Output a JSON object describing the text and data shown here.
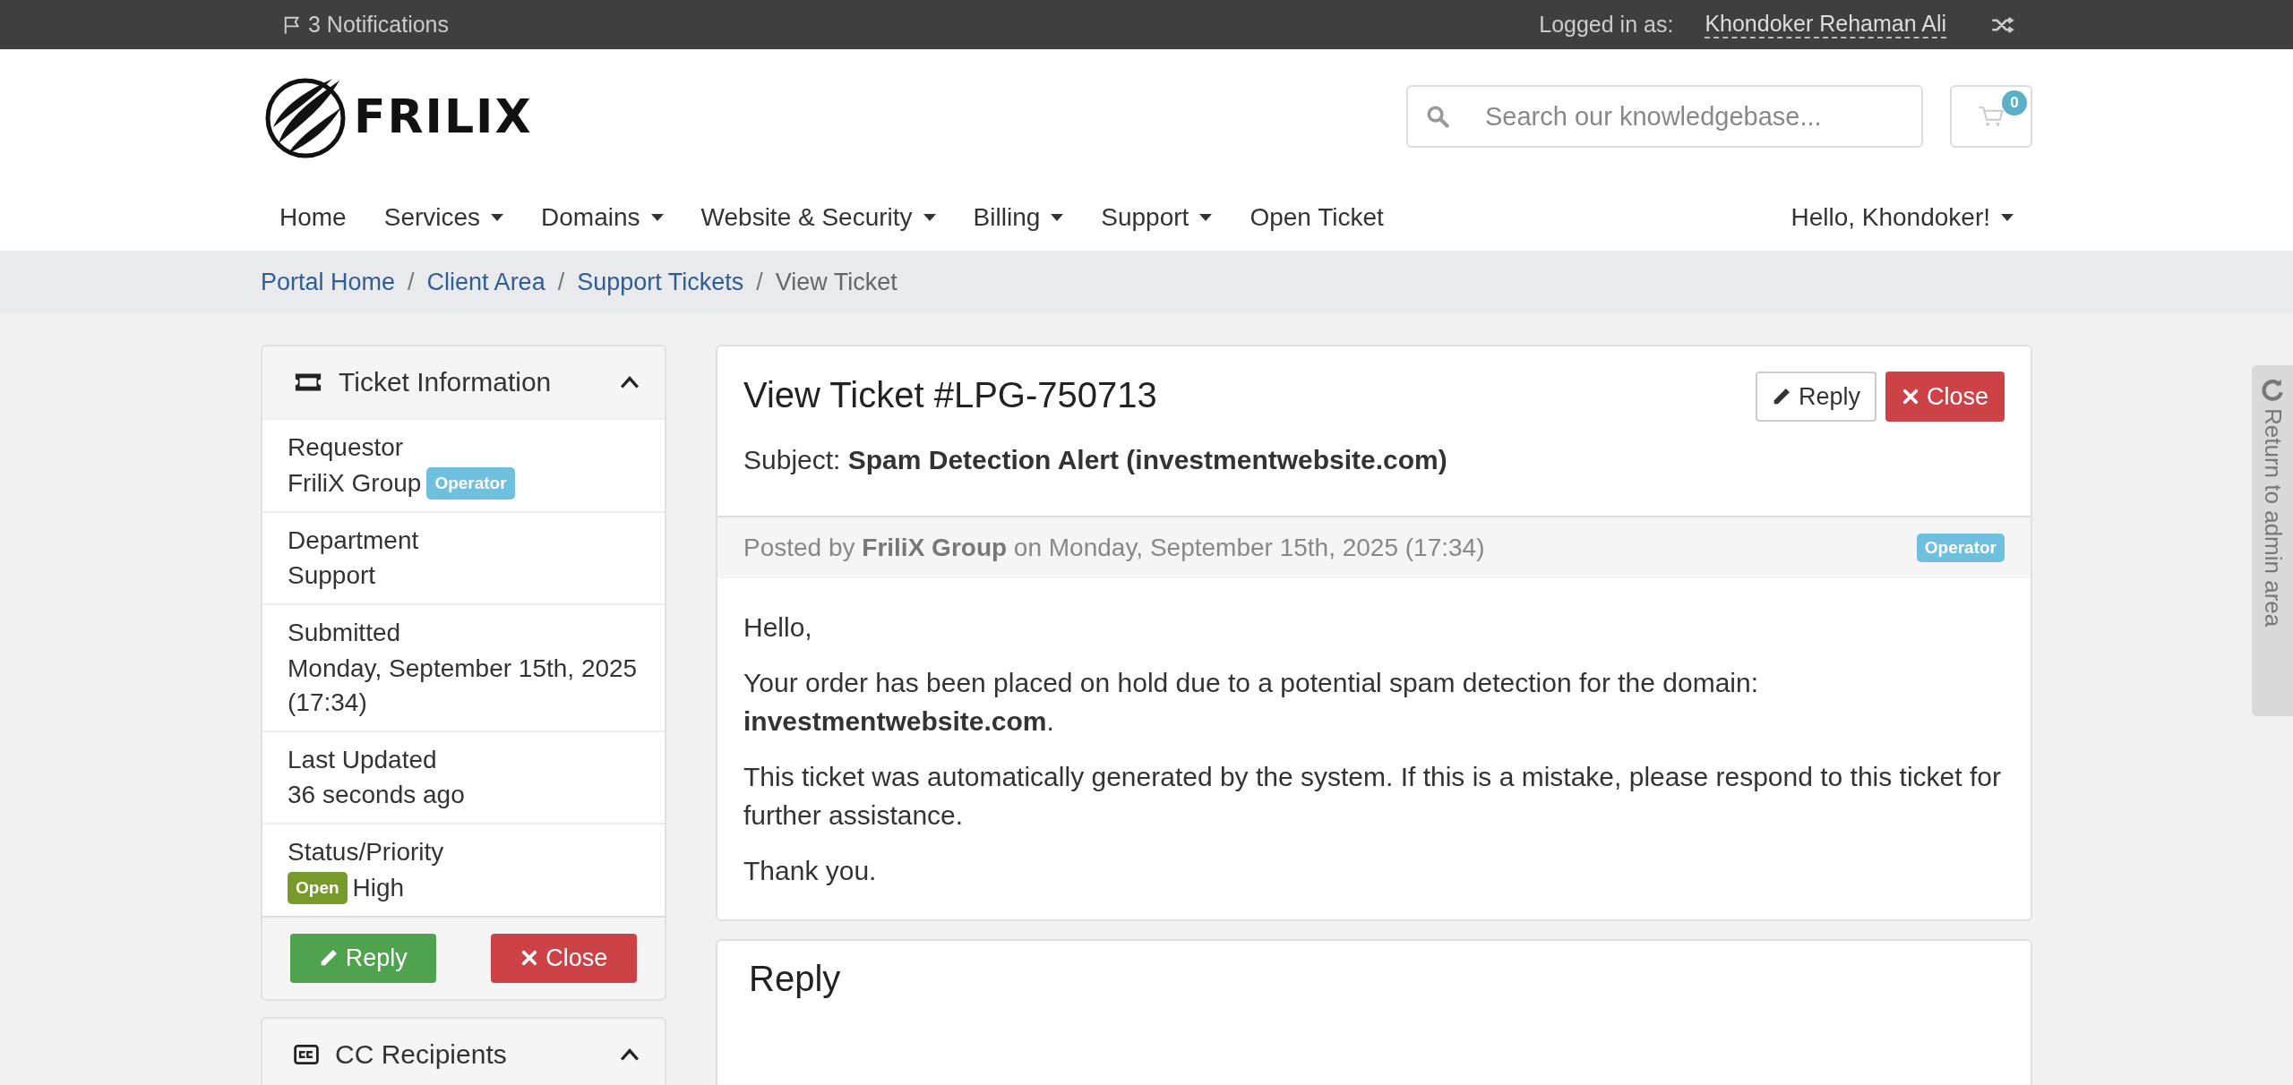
{
  "top_bar": {
    "notifications": "3 Notifications",
    "logged_in_label": "Logged in as:",
    "user_name": "Khondoker Rehaman Ali"
  },
  "header": {
    "logo_text": "FRILIX",
    "search": {
      "placeholder": "Search our knowledgebase..."
    },
    "cart_count": "0"
  },
  "nav": {
    "items": [
      {
        "label": "Home",
        "dropdown": false
      },
      {
        "label": "Services",
        "dropdown": true
      },
      {
        "label": "Domains",
        "dropdown": true
      },
      {
        "label": "Website & Security",
        "dropdown": true
      },
      {
        "label": "Billing",
        "dropdown": true
      },
      {
        "label": "Support",
        "dropdown": true
      },
      {
        "label": "Open Ticket",
        "dropdown": false
      }
    ],
    "user_menu": {
      "label": "Hello, Khondoker!",
      "dropdown": true
    }
  },
  "breadcrumb": [
    {
      "label": "Portal Home",
      "selected": false
    },
    {
      "label": "Client Area",
      "selected": false,
      "separator": "/"
    },
    {
      "label": "Support Tickets",
      "selected": false,
      "separator": "/"
    },
    {
      "label": "View Ticket",
      "selected": true,
      "separator": "/"
    }
  ],
  "sidebar": {
    "ticket_information": {
      "title": "Ticket Information",
      "expanded": true,
      "fields": [
        {
          "label": "Requestor",
          "value": [
            {
              "kind": "text",
              "text": "FriliX Group"
            },
            {
              "kind": "badge",
              "text": "Operator",
              "color": "#6fbfdf"
            }
          ]
        },
        {
          "label": "Department",
          "value": [
            {
              "kind": "text",
              "text": "Support"
            }
          ]
        },
        {
          "label": "Submitted",
          "value": [
            {
              "kind": "text",
              "text": "Monday, September 15th, 2025 (17:34)"
            }
          ]
        },
        {
          "label": "Last Updated",
          "value": [
            {
              "kind": "text",
              "text": "36 seconds ago"
            }
          ]
        },
        {
          "label": "Status/Priority",
          "value": [
            {
              "kind": "badge",
              "text": "Open",
              "color": "#779a2b"
            },
            {
              "kind": "text",
              "text": "High"
            }
          ]
        }
      ],
      "buttons": [
        {
          "kind": "reply",
          "label": "Reply"
        },
        {
          "kind": "close",
          "label": "Close"
        }
      ]
    },
    "cc_recipients": {
      "title": "CC Recipients",
      "expanded": true
    }
  },
  "ticket": {
    "title": "View Ticket #LPG-750713",
    "actions": [
      {
        "kind": "reply",
        "label": "Reply"
      },
      {
        "kind": "close",
        "label": "Close"
      }
    ],
    "subject": "Subject: **Spam Detection Alert (investmentwebsite.com)**",
    "message": {
      "posted": "Posted by **FriliX Group** on Monday, September 15th, 2025 (17:34)",
      "badge": "Operator",
      "paragraphs": [
        "Hello,",
        "Your order has been placed on hold due to a potential spam detection for the domain: **investmentwebsite.com**.",
        "This ticket was automatically generated by the system. If this is a mistake, please respond to this ticket for further assistance.",
        "Thank you."
      ]
    }
  },
  "reply": {
    "title": "Reply"
  },
  "admin_tab": {
    "label": "Return to admin area"
  }
}
